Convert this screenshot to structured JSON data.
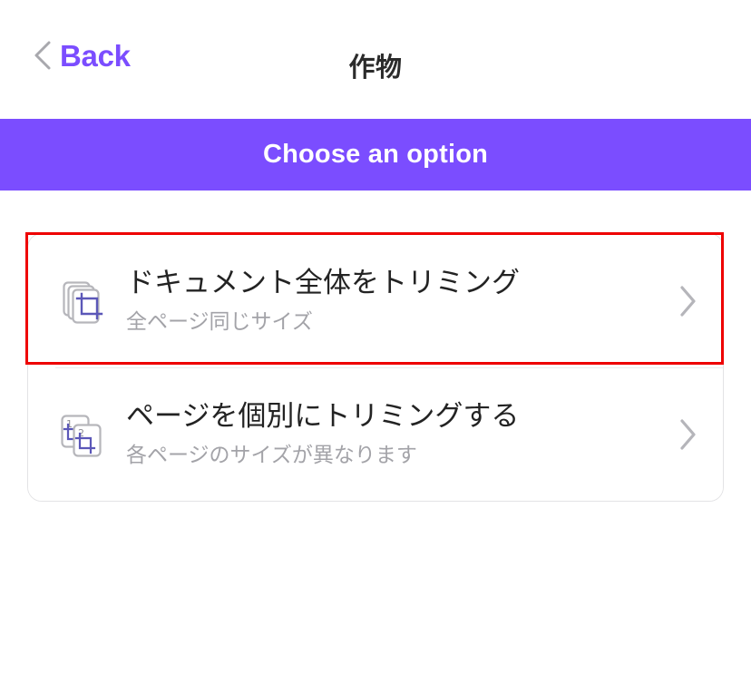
{
  "navbar": {
    "back_label": "Back",
    "back_icon": "chevron-left-icon",
    "title": "作物"
  },
  "banner": {
    "text": "Choose an option",
    "color": "#7b4dff"
  },
  "options": [
    {
      "icon": "crop-whole-document-icon",
      "title": "ドキュメント全体をトリミング",
      "subtitle": "全ページ同じサイズ",
      "chevron": "chevron-right-icon",
      "highlighted": true
    },
    {
      "icon": "crop-pages-individually-icon",
      "title": "ページを個別にトリミングする",
      "subtitle": "各ページのサイズが異なります",
      "chevron": "chevron-right-icon",
      "highlighted": false
    }
  ],
  "highlight": {
    "color": "#ee0000"
  }
}
